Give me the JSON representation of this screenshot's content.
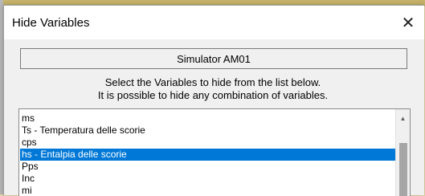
{
  "dialog": {
    "title": "Hide Variables",
    "close_glyph": "✕",
    "simulator_label": "Simulator AM01",
    "instruction_line1": "Select the Variables to hide from the list below.",
    "instruction_line2": "It is possible to hide any combination of variables."
  },
  "list": {
    "items": [
      "ms",
      "Ts - Temperatura delle scorie",
      "cps",
      "hs - Entalpia delle scorie",
      "Pps",
      "Inc",
      "mi"
    ],
    "selected_item": "hs - Entalpia delle scorie",
    "scroll_up_glyph": "▲"
  },
  "colors": {
    "selection": "#0078d7",
    "window_bg": "#f0f0f0"
  }
}
